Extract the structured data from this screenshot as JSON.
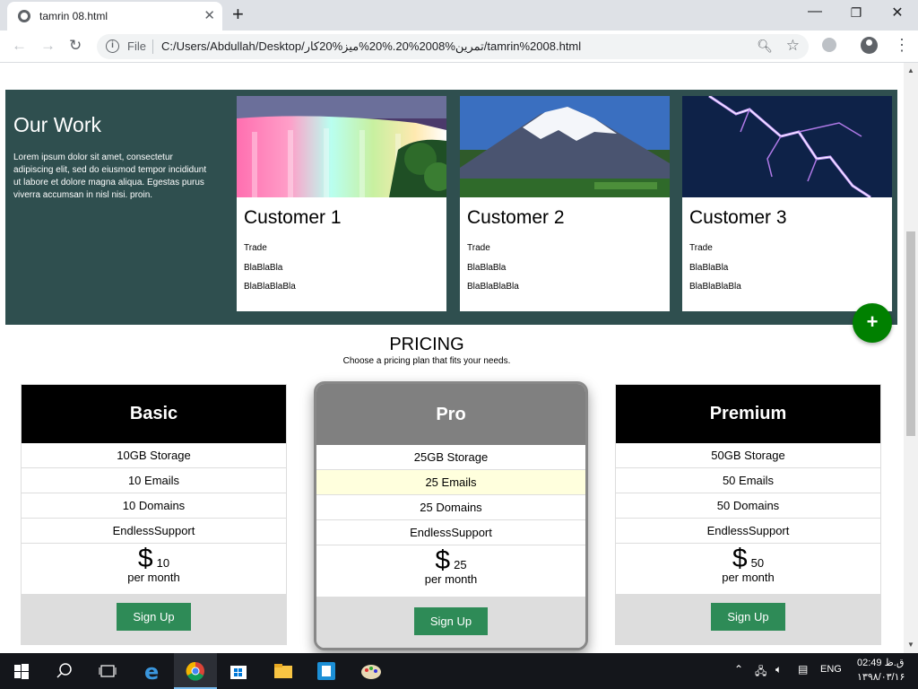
{
  "browser": {
    "tab_title": "tamrin 08.html",
    "omnibox_scheme": "File",
    "url": "C:/Users/Abdullah/Desktop/تمرین%2008%20.%20%میز%20کار/tamrin%2008.html"
  },
  "our_work": {
    "title": "Our Work",
    "text": "Lorem ipsum dolor sit amet, consectetur adipiscing elit, sed do eiusmod tempor incididunt ut labore et dolore magna aliqua. Egestas purus viverra accumsan in nisl nisi. proin.",
    "cards": [
      {
        "name": "Customer 1",
        "line1": "Trade",
        "line2": "BlaBlaBla",
        "line3": "BlaBlaBlaBla"
      },
      {
        "name": "Customer 2",
        "line1": "Trade",
        "line2": "BlaBlaBla",
        "line3": "BlaBlaBlaBla"
      },
      {
        "name": "Customer 3",
        "line1": "Trade",
        "line2": "BlaBlaBla",
        "line3": "BlaBlaBlaBla"
      }
    ],
    "fab_label": "+"
  },
  "pricing": {
    "title": "PRICING",
    "subtitle": "Choose a pricing plan that fits your needs.",
    "plans": [
      {
        "name": "Basic",
        "storage_num": "10GB",
        "storage_label": "Storage",
        "emails_num": "10",
        "emails_label": "Emails",
        "domains_num": "10",
        "domains_label": "Domains",
        "support_num": "Endless",
        "support_label": "Support",
        "currency": "$",
        "price": "10",
        "per": "per month",
        "button": "Sign Up",
        "header_color": "#000000"
      },
      {
        "name": "Pro",
        "storage_num": "25GB",
        "storage_label": "Storage",
        "emails_num": "25",
        "emails_label": "Emails",
        "domains_num": "25",
        "domains_label": "Domains",
        "support_num": "Endless",
        "support_label": "Support",
        "currency": "$",
        "price": "25",
        "per": "per month",
        "button": "Sign Up",
        "header_color": "#808080"
      },
      {
        "name": "Premium",
        "storage_num": "50GB",
        "storage_label": "Storage",
        "emails_num": "50",
        "emails_label": "Emails",
        "domains_num": "50",
        "domains_label": "Domains",
        "support_num": "Endless",
        "support_label": "Support",
        "currency": "$",
        "price": "50",
        "per": "per month",
        "button": "Sign Up",
        "header_color": "#000000"
      }
    ]
  },
  "taskbar": {
    "lang": "ENG",
    "time": "02:49 ق.ظ",
    "date": "۱۳۹۸/۰۳/۱۶"
  },
  "colors": {
    "our_work_bg": "#2f4f4f",
    "fab": "#008000",
    "signup": "#2e8b57",
    "highlight_row": "#ffffdd"
  }
}
